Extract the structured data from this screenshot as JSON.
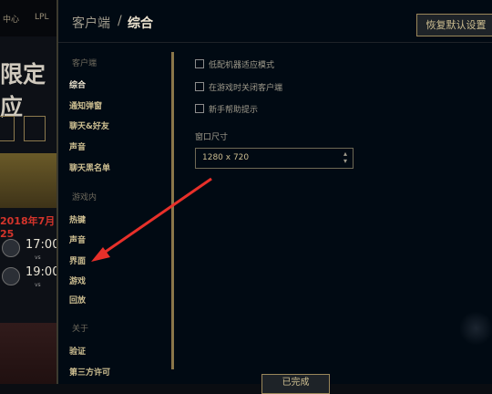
{
  "background": {
    "topnav": [
      "中心",
      "LPL"
    ],
    "title_fragment": "限定应",
    "date": "2018年7月25",
    "matches": [
      {
        "time": "17:00",
        "vs": "vs"
      },
      {
        "time": "19:00",
        "vs": "vs"
      }
    ]
  },
  "header": {
    "breadcrumb_root": "客户端",
    "separator": "/",
    "breadcrumb_current": "综合",
    "reset_label": "恢复默认设置"
  },
  "sidebar": {
    "sections": [
      {
        "label": "客户端",
        "items": [
          "综合",
          "通知弹窗",
          "聊天&好友",
          "声音",
          "聊天黑名单"
        ]
      },
      {
        "label": "游戏内",
        "items": [
          "热键",
          "声音",
          "界面",
          "游戏",
          "回放"
        ]
      },
      {
        "label": "关于",
        "items": [
          "验证",
          "第三方许可"
        ]
      }
    ],
    "active": "综合"
  },
  "content": {
    "checkboxes": [
      {
        "label": "低配机器适应模式",
        "checked": false
      },
      {
        "label": "在游戏时关闭客户端",
        "checked": false
      },
      {
        "label": "新手帮助提示",
        "checked": false
      }
    ],
    "window_size_label": "窗口尺寸",
    "window_size_value": "1280 x 720"
  },
  "footer": {
    "done_label": "已完成"
  },
  "colors": {
    "accent_gold": "#9a875a",
    "annotation_red": "#e8302a",
    "background": "#010a13"
  }
}
